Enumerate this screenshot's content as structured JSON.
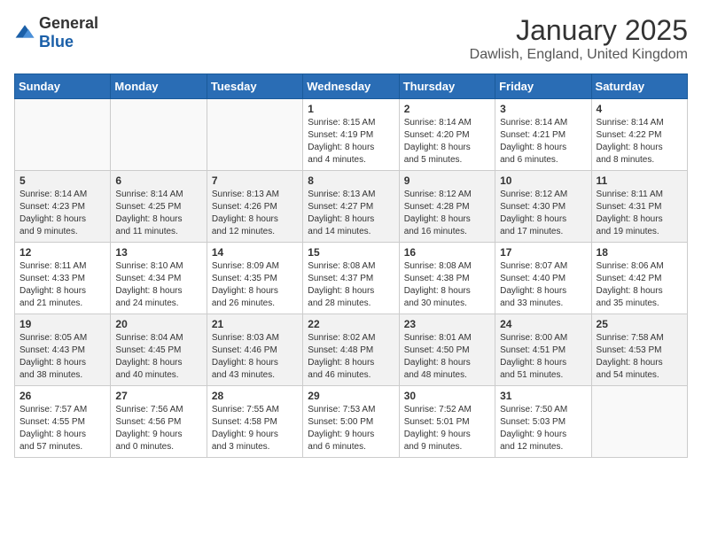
{
  "logo": {
    "general": "General",
    "blue": "Blue"
  },
  "title": "January 2025",
  "location": "Dawlish, England, United Kingdom",
  "days_of_week": [
    "Sunday",
    "Monday",
    "Tuesday",
    "Wednesday",
    "Thursday",
    "Friday",
    "Saturday"
  ],
  "weeks": [
    {
      "shaded": false,
      "days": [
        {
          "num": "",
          "info": ""
        },
        {
          "num": "",
          "info": ""
        },
        {
          "num": "",
          "info": ""
        },
        {
          "num": "1",
          "info": "Sunrise: 8:15 AM\nSunset: 4:19 PM\nDaylight: 8 hours\nand 4 minutes."
        },
        {
          "num": "2",
          "info": "Sunrise: 8:14 AM\nSunset: 4:20 PM\nDaylight: 8 hours\nand 5 minutes."
        },
        {
          "num": "3",
          "info": "Sunrise: 8:14 AM\nSunset: 4:21 PM\nDaylight: 8 hours\nand 6 minutes."
        },
        {
          "num": "4",
          "info": "Sunrise: 8:14 AM\nSunset: 4:22 PM\nDaylight: 8 hours\nand 8 minutes."
        }
      ]
    },
    {
      "shaded": true,
      "days": [
        {
          "num": "5",
          "info": "Sunrise: 8:14 AM\nSunset: 4:23 PM\nDaylight: 8 hours\nand 9 minutes."
        },
        {
          "num": "6",
          "info": "Sunrise: 8:14 AM\nSunset: 4:25 PM\nDaylight: 8 hours\nand 11 minutes."
        },
        {
          "num": "7",
          "info": "Sunrise: 8:13 AM\nSunset: 4:26 PM\nDaylight: 8 hours\nand 12 minutes."
        },
        {
          "num": "8",
          "info": "Sunrise: 8:13 AM\nSunset: 4:27 PM\nDaylight: 8 hours\nand 14 minutes."
        },
        {
          "num": "9",
          "info": "Sunrise: 8:12 AM\nSunset: 4:28 PM\nDaylight: 8 hours\nand 16 minutes."
        },
        {
          "num": "10",
          "info": "Sunrise: 8:12 AM\nSunset: 4:30 PM\nDaylight: 8 hours\nand 17 minutes."
        },
        {
          "num": "11",
          "info": "Sunrise: 8:11 AM\nSunset: 4:31 PM\nDaylight: 8 hours\nand 19 minutes."
        }
      ]
    },
    {
      "shaded": false,
      "days": [
        {
          "num": "12",
          "info": "Sunrise: 8:11 AM\nSunset: 4:33 PM\nDaylight: 8 hours\nand 21 minutes."
        },
        {
          "num": "13",
          "info": "Sunrise: 8:10 AM\nSunset: 4:34 PM\nDaylight: 8 hours\nand 24 minutes."
        },
        {
          "num": "14",
          "info": "Sunrise: 8:09 AM\nSunset: 4:35 PM\nDaylight: 8 hours\nand 26 minutes."
        },
        {
          "num": "15",
          "info": "Sunrise: 8:08 AM\nSunset: 4:37 PM\nDaylight: 8 hours\nand 28 minutes."
        },
        {
          "num": "16",
          "info": "Sunrise: 8:08 AM\nSunset: 4:38 PM\nDaylight: 8 hours\nand 30 minutes."
        },
        {
          "num": "17",
          "info": "Sunrise: 8:07 AM\nSunset: 4:40 PM\nDaylight: 8 hours\nand 33 minutes."
        },
        {
          "num": "18",
          "info": "Sunrise: 8:06 AM\nSunset: 4:42 PM\nDaylight: 8 hours\nand 35 minutes."
        }
      ]
    },
    {
      "shaded": true,
      "days": [
        {
          "num": "19",
          "info": "Sunrise: 8:05 AM\nSunset: 4:43 PM\nDaylight: 8 hours\nand 38 minutes."
        },
        {
          "num": "20",
          "info": "Sunrise: 8:04 AM\nSunset: 4:45 PM\nDaylight: 8 hours\nand 40 minutes."
        },
        {
          "num": "21",
          "info": "Sunrise: 8:03 AM\nSunset: 4:46 PM\nDaylight: 8 hours\nand 43 minutes."
        },
        {
          "num": "22",
          "info": "Sunrise: 8:02 AM\nSunset: 4:48 PM\nDaylight: 8 hours\nand 46 minutes."
        },
        {
          "num": "23",
          "info": "Sunrise: 8:01 AM\nSunset: 4:50 PM\nDaylight: 8 hours\nand 48 minutes."
        },
        {
          "num": "24",
          "info": "Sunrise: 8:00 AM\nSunset: 4:51 PM\nDaylight: 8 hours\nand 51 minutes."
        },
        {
          "num": "25",
          "info": "Sunrise: 7:58 AM\nSunset: 4:53 PM\nDaylight: 8 hours\nand 54 minutes."
        }
      ]
    },
    {
      "shaded": false,
      "days": [
        {
          "num": "26",
          "info": "Sunrise: 7:57 AM\nSunset: 4:55 PM\nDaylight: 8 hours\nand 57 minutes."
        },
        {
          "num": "27",
          "info": "Sunrise: 7:56 AM\nSunset: 4:56 PM\nDaylight: 9 hours\nand 0 minutes."
        },
        {
          "num": "28",
          "info": "Sunrise: 7:55 AM\nSunset: 4:58 PM\nDaylight: 9 hours\nand 3 minutes."
        },
        {
          "num": "29",
          "info": "Sunrise: 7:53 AM\nSunset: 5:00 PM\nDaylight: 9 hours\nand 6 minutes."
        },
        {
          "num": "30",
          "info": "Sunrise: 7:52 AM\nSunset: 5:01 PM\nDaylight: 9 hours\nand 9 minutes."
        },
        {
          "num": "31",
          "info": "Sunrise: 7:50 AM\nSunset: 5:03 PM\nDaylight: 9 hours\nand 12 minutes."
        },
        {
          "num": "",
          "info": ""
        }
      ]
    }
  ]
}
